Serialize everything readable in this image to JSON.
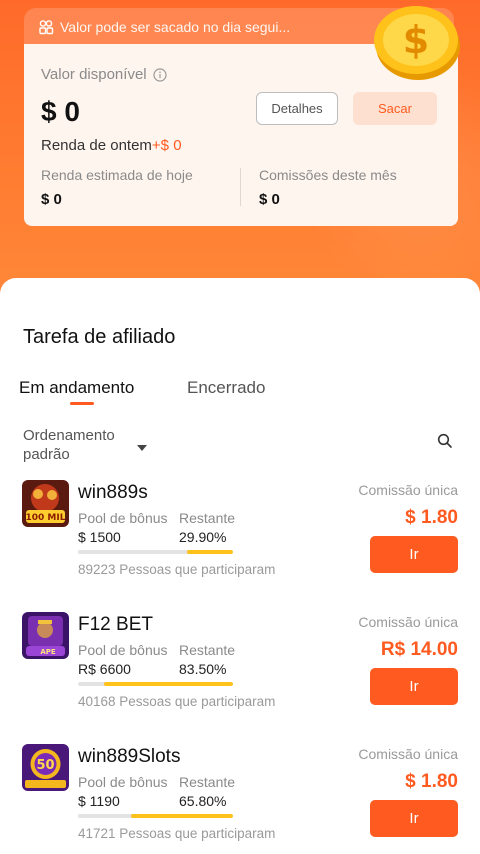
{
  "notice": {
    "text": "Valor pode ser sacado no dia segui..."
  },
  "balance_card": {
    "available_label": "Valor disponível",
    "balance": "$ 0",
    "details_button": "Detalhes",
    "withdraw_button": "Sacar",
    "yesterday_label": "Renda de ontem",
    "yesterday_value": "+$ 0",
    "today_estimated_label": "Renda estimada de hoje",
    "today_estimated_value": "$ 0",
    "month_commissions_label": "Comissões deste mês",
    "month_commissions_value": "$ 0"
  },
  "section": {
    "title": "Tarefa de afiliado",
    "tabs": [
      {
        "label": "Em andamento",
        "active": true
      },
      {
        "label": "Encerrado",
        "active": false
      }
    ],
    "sort_label": "Ordenamento padrão"
  },
  "tasks": [
    {
      "name": "win889s",
      "pool_label": "Pool de bônus",
      "pool_value": "$ 1500",
      "remaining_label": "Restante",
      "remaining_value": "29.90%",
      "remaining_fraction": 0.299,
      "participants": "89223 Pessoas que participaram",
      "commission_label": "Comissão única",
      "commission_value": "$ 1.80",
      "button": "Ir",
      "thumb_text": "100 MIL"
    },
    {
      "name": "F12 BET",
      "pool_label": "Pool de bônus",
      "pool_value": "R$ 6600",
      "remaining_label": "Restante",
      "remaining_value": "83.50%",
      "remaining_fraction": 0.835,
      "participants": "40168 Pessoas que participaram",
      "commission_label": "Comissão única",
      "commission_value": "R$ 14.00",
      "button": "Ir",
      "thumb_text": "APE"
    },
    {
      "name": "win889Slots",
      "pool_label": "Pool de bônus",
      "pool_value": "$ 1190",
      "remaining_label": "Restante",
      "remaining_value": "65.80%",
      "remaining_fraction": 0.658,
      "participants": "41721 Pessoas que participaram",
      "commission_label": "Comissão única",
      "commission_value": "$ 1.80",
      "button": "Ir",
      "thumb_text": "50"
    }
  ],
  "colors": {
    "accent": "#ff5a1f",
    "progress": "#ffc21a",
    "hero": "#ff7a30"
  },
  "icons": [
    "users-icon",
    "info-icon",
    "coin-icon",
    "caret-down-icon",
    "search-icon"
  ]
}
